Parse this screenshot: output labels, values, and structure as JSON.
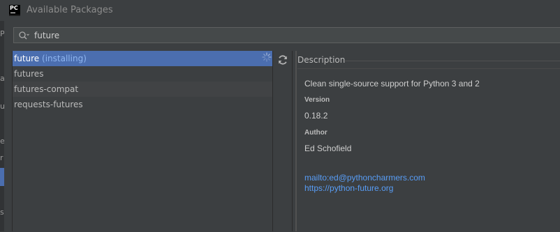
{
  "window": {
    "app_icon_text": "PC",
    "title": "Available Packages"
  },
  "sidebar_fragments": [
    "P",
    "a",
    "u",
    "e",
    "r",
    "s"
  ],
  "search": {
    "value": "future",
    "icon": "search-icon"
  },
  "packages": [
    {
      "name": "future",
      "status": "(installing)",
      "selected": true
    },
    {
      "name": "futures"
    },
    {
      "name": "futures-compat"
    },
    {
      "name": "requests-futures"
    }
  ],
  "toolbar": {
    "refresh_icon": "refresh-icon"
  },
  "description": {
    "heading": "Description",
    "summary": "Clean single-source support for Python 3 and 2",
    "version_label": "Version",
    "version": "0.18.2",
    "author_label": "Author",
    "author": "Ed Schofield",
    "links": [
      "mailto:ed@pythoncharmers.com",
      "https://python-future.org"
    ]
  },
  "colors": {
    "selection": "#4b6eaf",
    "link": "#589df6",
    "status": "#8fb6f0",
    "background": "#3c3f41"
  }
}
